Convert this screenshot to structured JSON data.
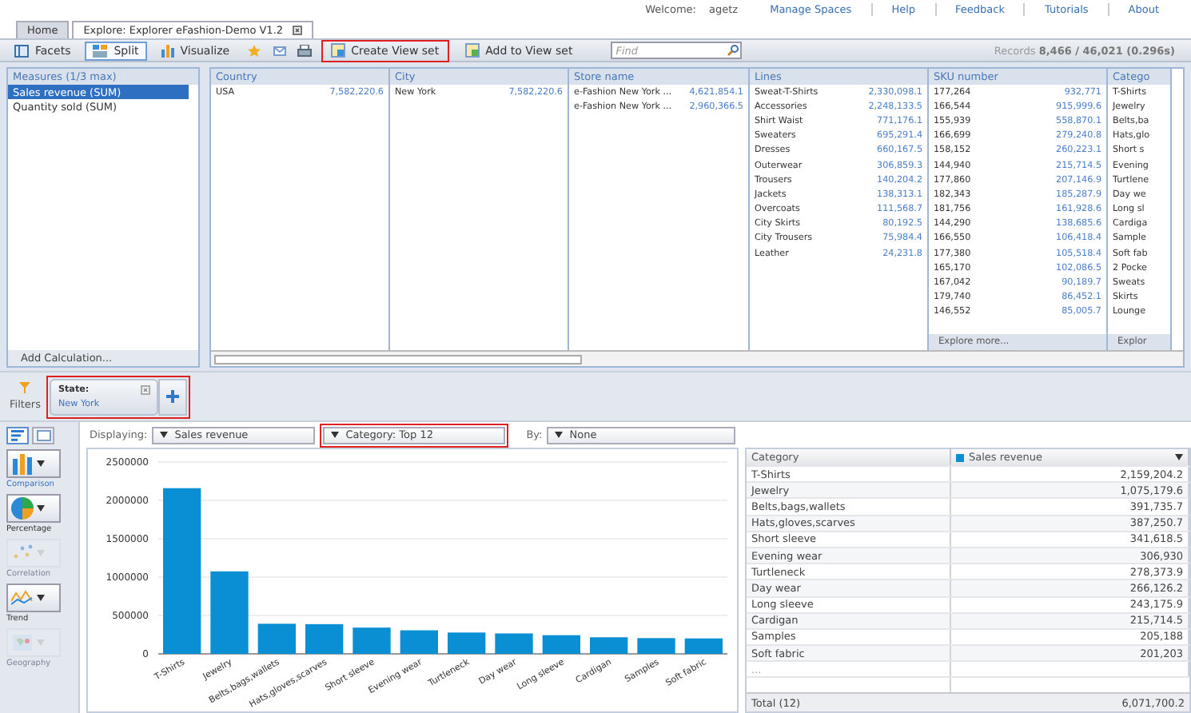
{
  "header": {
    "welcome_label": "Welcome:",
    "user": "agetz",
    "links": [
      "Manage Spaces",
      "Help",
      "Feedback",
      "Tutorials",
      "About"
    ]
  },
  "tabs": [
    {
      "label": "Home",
      "selected": false,
      "closable": false
    },
    {
      "label": "Explore: Explorer eFashion-Demo V1.2",
      "selected": true,
      "closable": true
    }
  ],
  "toolbar": {
    "modes": [
      {
        "label": "Facets",
        "selected": false
      },
      {
        "label": "Split",
        "selected": true
      },
      {
        "label": "Visualize",
        "selected": false
      }
    ],
    "actions": [
      {
        "label": "Create View set",
        "highlighted": true
      },
      {
        "label": "Add to View set",
        "highlighted": false
      }
    ],
    "search": {
      "placeholder": "Find"
    },
    "records_label": "Records",
    "records_value": "8,466 / 46,021 (0.296s)"
  },
  "measures": {
    "title": "Measures (1/3 max)",
    "items": [
      {
        "label": "Sales revenue (SUM)",
        "selected": true
      },
      {
        "label": "Quantity sold (SUM)",
        "selected": false
      }
    ],
    "footer": "Add Calculation..."
  },
  "facets": [
    {
      "title": "Country",
      "rows": [
        {
          "label": "USA",
          "value": "7,582,220.6"
        }
      ]
    },
    {
      "title": "City",
      "rows": [
        {
          "label": "New York",
          "value": "7,582,220.6"
        }
      ]
    },
    {
      "title": "Store name",
      "rows": [
        {
          "label": "e-Fashion New York ...",
          "value": "4,621,854.1"
        },
        {
          "label": "e-Fashion New York ...",
          "value": "2,960,366.5"
        }
      ]
    },
    {
      "title": "Lines",
      "rows": [
        {
          "label": "Sweat-T-Shirts",
          "value": "2,330,098.1"
        },
        {
          "label": "Accessories",
          "value": "2,248,133.5"
        },
        {
          "label": "Shirt Waist",
          "value": "771,176.1"
        },
        {
          "label": "Sweaters",
          "value": "695,291.4"
        },
        {
          "label": "Dresses",
          "value": "660,167.5"
        },
        {
          "label": "Outerwear",
          "value": "306,859.3"
        },
        {
          "label": "Trousers",
          "value": "140,204.2"
        },
        {
          "label": "Jackets",
          "value": "138,313.1"
        },
        {
          "label": "Overcoats",
          "value": "111,568.7"
        },
        {
          "label": "City Skirts",
          "value": "80,192.5"
        },
        {
          "label": "City Trousers",
          "value": "75,984.4"
        },
        {
          "label": "Leather",
          "value": "24,231.8"
        }
      ]
    },
    {
      "title": "SKU number",
      "footer": "Explore more...",
      "rows": [
        {
          "label": "177,264",
          "value": "932,771"
        },
        {
          "label": "166,544",
          "value": "915,999.6"
        },
        {
          "label": "155,939",
          "value": "558,870.1"
        },
        {
          "label": "166,699",
          "value": "279,240.8"
        },
        {
          "label": "158,152",
          "value": "260,223.1"
        },
        {
          "label": "144,940",
          "value": "215,714.5"
        },
        {
          "label": "177,860",
          "value": "207,146.9"
        },
        {
          "label": "182,343",
          "value": "185,287.9"
        },
        {
          "label": "181,756",
          "value": "161,928.6"
        },
        {
          "label": "144,290",
          "value": "138,685.6"
        },
        {
          "label": "166,550",
          "value": "106,418.4"
        },
        {
          "label": "177,380",
          "value": "105,518.4"
        },
        {
          "label": "165,170",
          "value": "102,086.5"
        },
        {
          "label": "167,042",
          "value": "90,189.7"
        },
        {
          "label": "179,740",
          "value": "86,452.1"
        },
        {
          "label": "146,552",
          "value": "85,005.7"
        }
      ]
    },
    {
      "title": "Catego",
      "footer": "Explor",
      "rows": [
        {
          "label": "T-Shirts"
        },
        {
          "label": "Jewelry"
        },
        {
          "label": "Belts,ba"
        },
        {
          "label": "Hats,glo"
        },
        {
          "label": "Short s"
        },
        {
          "label": "Evening"
        },
        {
          "label": "Turtlene"
        },
        {
          "label": "Day we"
        },
        {
          "label": "Long sl"
        },
        {
          "label": "Cardiga"
        },
        {
          "label": "Sample"
        },
        {
          "label": "Soft fab"
        },
        {
          "label": "2 Pocke"
        },
        {
          "label": "Sweats"
        },
        {
          "label": "Skirts"
        },
        {
          "label": "Lounge"
        }
      ]
    }
  ],
  "filters": {
    "label": "Filters",
    "highlighted": true,
    "chips": [
      {
        "name": "State:",
        "value": "New York"
      }
    ]
  },
  "viz": {
    "view_toggle": [
      {
        "kind": "chart",
        "selected": true
      },
      {
        "kind": "table",
        "selected": false
      }
    ],
    "chart_types": [
      {
        "label": "Comparison",
        "disabled": false,
        "selected": true
      },
      {
        "label": "Percentage",
        "disabled": false,
        "selected": false
      },
      {
        "label": "Correlation",
        "disabled": true,
        "selected": false
      },
      {
        "label": "Trend",
        "disabled": false,
        "selected": false
      },
      {
        "label": "Geography",
        "disabled": true,
        "selected": false
      }
    ],
    "displaying_label": "Displaying:",
    "measure": "Sales revenue",
    "category": "Category: Top 12",
    "category_highlighted": true,
    "by_label": "By:",
    "by": "None",
    "chart_data": {
      "type": "bar",
      "categories": [
        "T-Shirts",
        "Jewelry",
        "Belts,bags,wallets",
        "Hats,gloves,scarves",
        "Short sleeve",
        "Evening wear",
        "Turtleneck",
        "Day wear",
        "Long sleeve",
        "Cardigan",
        "Samples",
        "Soft fabric"
      ],
      "values": [
        2159000,
        1075000,
        392000,
        387000,
        342000,
        307000,
        278000,
        266000,
        243000,
        216000,
        205000,
        201000
      ],
      "ylim": [
        0,
        2500000
      ],
      "yticks": [
        0,
        500000,
        1000000,
        1500000,
        2000000,
        2500000
      ],
      "grid": true
    },
    "table": {
      "columns": [
        "Category",
        "Sales revenue"
      ],
      "rows": [
        [
          "T-Shirts",
          "2,159,204.2"
        ],
        [
          "Jewelry",
          "1,075,179.6"
        ],
        [
          "Belts,bags,wallets",
          "391,735.7"
        ],
        [
          "Hats,gloves,scarves",
          "387,250.7"
        ],
        [
          "Short sleeve",
          "341,618.5"
        ],
        [
          "Evening wear",
          "306,930"
        ],
        [
          "Turtleneck",
          "278,373.9"
        ],
        [
          "Day wear",
          "266,126.2"
        ],
        [
          "Long sleeve",
          "243,175.9"
        ],
        [
          "Cardigan",
          "215,714.5"
        ],
        [
          "Samples",
          "205,188"
        ],
        [
          "Soft fabric",
          "201,203"
        ]
      ],
      "ellipsis": "...",
      "total": [
        "Total (12)",
        "6,071,700.2"
      ]
    }
  }
}
